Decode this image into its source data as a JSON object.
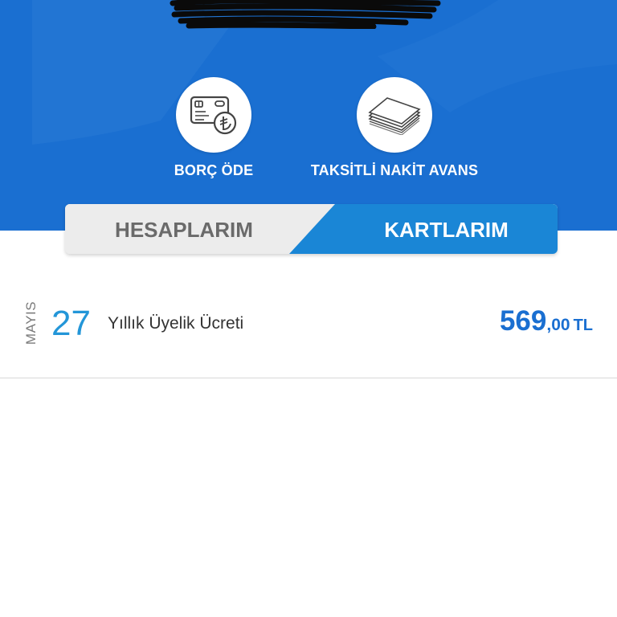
{
  "header": {
    "background_color": "#1a6fd1"
  },
  "actions": [
    {
      "label": "BORÇ ÖDE",
      "icon": "card-lira-icon"
    },
    {
      "label": "TAKSİTLİ NAKİT AVANS",
      "icon": "cash-stack-icon"
    }
  ],
  "tabs": [
    {
      "label": "HESAPLARIM",
      "active": false
    },
    {
      "label": "KARTLARIM",
      "active": true
    }
  ],
  "transactions": [
    {
      "month": "MAYIS",
      "day": "27",
      "description": "Yıllık Üyelik Ücreti",
      "amount_int": "569",
      "amount_dec": ",00",
      "currency": "TL"
    }
  ],
  "colors": {
    "brand_blue": "#1a6fd1",
    "tab_active": "#1a86d6",
    "day_blue": "#2396d8"
  }
}
